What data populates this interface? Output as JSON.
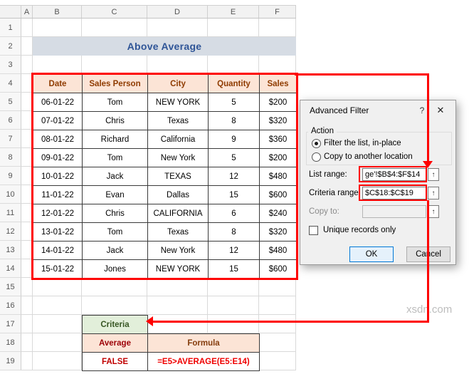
{
  "watermark": "xsdn.com",
  "spreadsheet": {
    "column_headers": [
      "A",
      "B",
      "C",
      "D",
      "E",
      "F"
    ],
    "row_headers": [
      "1",
      "2",
      "3",
      "4",
      "5",
      "6",
      "7",
      "8",
      "9",
      "10",
      "11",
      "12",
      "13",
      "14",
      "15",
      "16",
      "17",
      "18",
      "19"
    ],
    "banner_title": "Above Average",
    "table": {
      "headers": [
        "Date",
        "Sales Person",
        "City",
        "Quantity",
        "Sales"
      ],
      "rows": [
        [
          "06-01-22",
          "Tom",
          "NEW YORK",
          "5",
          "$200"
        ],
        [
          "07-01-22",
          "Chris",
          "Texas",
          "8",
          "$320"
        ],
        [
          "08-01-22",
          "Richard",
          "California",
          "9",
          "$360"
        ],
        [
          "09-01-22",
          "Tom",
          "New York",
          "5",
          "$200"
        ],
        [
          "10-01-22",
          "Jack",
          "TEXAS",
          "12",
          "$480"
        ],
        [
          "11-01-22",
          "Evan",
          "Dallas",
          "15",
          "$600"
        ],
        [
          "12-01-22",
          "Chris",
          "CALIFORNIA",
          "6",
          "$240"
        ],
        [
          "13-01-22",
          "Tom",
          "Texas",
          "8",
          "$320"
        ],
        [
          "14-01-22",
          "Jack",
          "New York",
          "12",
          "$480"
        ],
        [
          "15-01-22",
          "Jones",
          "NEW YORK",
          "15",
          "$600"
        ]
      ]
    },
    "criteria": {
      "header": "Criteria",
      "field_header": "Average",
      "formula_header": "Formula",
      "value": "FALSE",
      "formula": "=E5>AVERAGE(E5:E14)"
    }
  },
  "dialog": {
    "title": "Advanced Filter",
    "help_icon": "?",
    "close_icon": "✕",
    "action_group_label": "Action",
    "filter_in_place_label": "Filter the list, in-place",
    "copy_to_location_label": "Copy to another location",
    "list_range_label": "List range:",
    "list_range_value": "ge'!$B$4:$F$14",
    "criteria_range_label": "Criteria range:",
    "criteria_range_value": "$C$18:$C$19",
    "copy_to_label": "Copy to:",
    "copy_to_value": "",
    "unique_records_label": "Unique records only",
    "ok_label": "OK",
    "cancel_label": "Cancel",
    "range_selector_icon": "↑"
  },
  "colors": {
    "annotation_red": "#FE0000",
    "banner_bg": "#D6DCE4",
    "banner_text": "#2F5597",
    "table_header_bg": "#FCE4D6",
    "criteria_header_bg": "#E2EFDA"
  }
}
